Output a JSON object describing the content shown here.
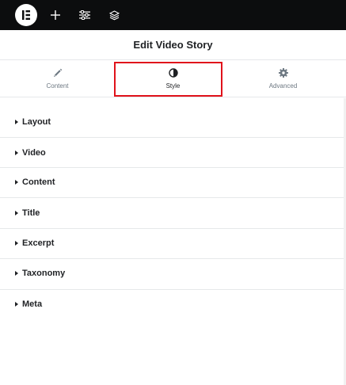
{
  "topbar": {
    "logo_icon": "elementor-logo-icon",
    "add_icon": "plus-icon",
    "settings_icon": "sliders-icon",
    "layers_icon": "layers-icon"
  },
  "panel": {
    "title": "Edit Video Story"
  },
  "tabs": [
    {
      "label": "Content",
      "icon": "pencil-icon"
    },
    {
      "label": "Style",
      "icon": "half-circle-icon",
      "active": true
    },
    {
      "label": "Advanced",
      "icon": "gear-icon"
    }
  ],
  "sections": [
    {
      "label": "Layout"
    },
    {
      "label": "Video"
    },
    {
      "label": "Content"
    },
    {
      "label": "Title"
    },
    {
      "label": "Excerpt"
    },
    {
      "label": "Taxonomy"
    },
    {
      "label": "Meta"
    }
  ],
  "colors": {
    "topbar_bg": "#0c0d0e",
    "highlight_border": "#e0121b",
    "text_dark": "#1f2124",
    "text_muted": "#6d7882",
    "divider": "#e6e8ea"
  }
}
